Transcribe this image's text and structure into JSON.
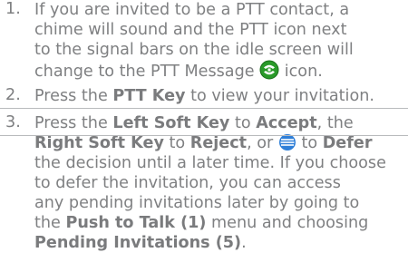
{
  "steps": [
    {
      "number": "1.",
      "lines": [
        "If you are invited to be a PTT contact, a",
        "chime will sound and the PTT icon next",
        "to the signal bars on the idle screen will"
      ],
      "line4_before": "change to the PTT Message",
      "line4_after": "icon."
    },
    {
      "number": "2.",
      "before": "Press the",
      "key": "PTT Key",
      "after": "to view your invitation."
    },
    {
      "number": "3.",
      "l1_a": "Press the",
      "l1_b": "Left Soft Key",
      "l1_c": "to",
      "l1_d": "Accept",
      "l1_e": ", the",
      "l2_a": "Right Soft Key",
      "l2_b": "to",
      "l2_c": "Reject",
      "l2_d": ", or",
      "l2_e": "to",
      "l2_f": "Defer",
      "l3": "the decision until a later time. If you choose",
      "l4": "to defer the invitation, you can access",
      "l5": "any pending invitations later by going to",
      "l6_a": "the",
      "l6_b": "Push to Talk (1)",
      "l6_c": "menu and choosing",
      "l7_a": "Pending Invitations (5)",
      "l7_b": "."
    }
  ],
  "colors": {
    "text": "#7f8082",
    "divider": "#b9bbbd",
    "ptt_icon": "#2a9a2a",
    "nav_icon": "#2f7fd8"
  },
  "icons": [
    "ptt-message-icon",
    "navigation-key-icon"
  ]
}
